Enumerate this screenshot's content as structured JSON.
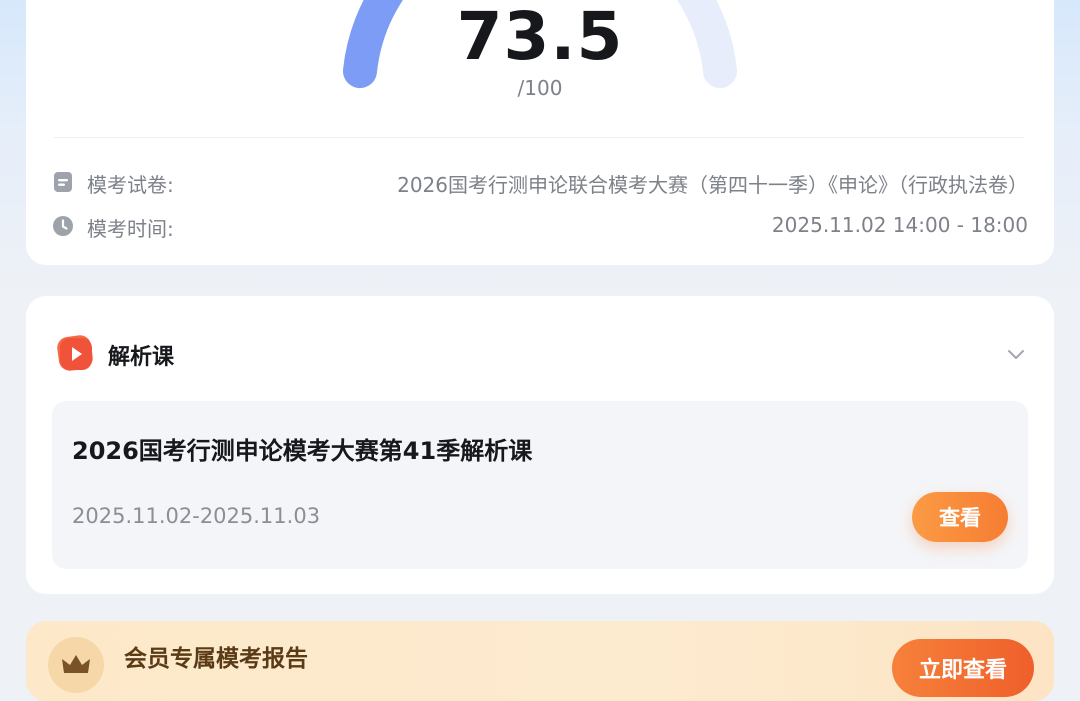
{
  "score": {
    "value": "73.5",
    "max_label": "/100",
    "fraction": 0.735,
    "gauge_color": "#7c9cf5",
    "track_color": "#e8edfb"
  },
  "info": {
    "paper_label": "模考试卷:",
    "paper_value": "2026国考行测申论联合模考大赛（第四十一季）《申论》（行政执法卷）",
    "time_label": "模考时间:",
    "time_value": "2025.11.02 14:00 - 18:00"
  },
  "course_section": {
    "title": "解析课",
    "course_name": "2026国考行测申论模考大赛第41季解析课",
    "date_range": "2025.11.02-2025.11.03",
    "view_button": "查看"
  },
  "member_section": {
    "title": "会员专属模考报告",
    "button": "立即查看"
  },
  "colors": {
    "accent_orange": "#f67d32",
    "icon_gray": "#9ea2aa",
    "video_icon_red": "#f0533a"
  }
}
